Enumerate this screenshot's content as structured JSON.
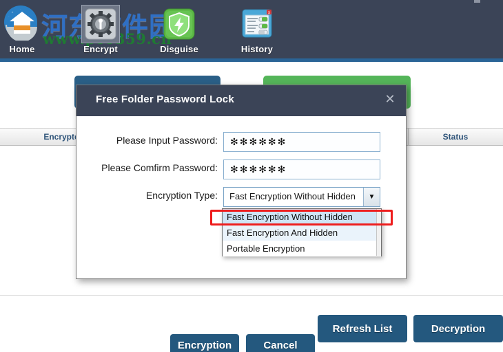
{
  "app": {
    "watermark_cn": "河东软件园",
    "watermark_url": "www.pc0359.cn"
  },
  "toolbar": {
    "items": [
      {
        "label": "Home",
        "icon": "home-icon",
        "selected": false
      },
      {
        "label": "Encrypt",
        "icon": "encrypt-gear-icon",
        "selected": true
      },
      {
        "label": "Disguise",
        "icon": "disguise-shield-icon",
        "selected": false
      },
      {
        "label": "History",
        "icon": "history-window-icon",
        "selected": false
      }
    ]
  },
  "actions": {
    "encrypt_folder_label": "",
    "decrypt_folder_label": ""
  },
  "table": {
    "columns": [
      "Encrypted File/F",
      "Status"
    ],
    "rows": []
  },
  "footer": {
    "refresh_label": "Refresh List",
    "decryption_label": "Decryption"
  },
  "dialog": {
    "title": "Free Folder Password Lock",
    "close_icon": "close-icon",
    "fields": {
      "password_label": "Please Input Password:",
      "password_value": "✻✻✻✻✻✻",
      "password_placeholder": "",
      "confirm_label": "Please Comfirm Password:",
      "confirm_value": "✻✻✻✻✻✻",
      "confirm_placeholder": "",
      "type_label": "Encryption Type:",
      "type_value": "Fast Encryption Without Hidden"
    },
    "dropdown": {
      "open": true,
      "options": [
        "Fast Encryption Without Hidden",
        "Fast Encryption And Hidden",
        "Portable Encryption"
      ],
      "selected_index": 0,
      "highlight_color": "#cfe4f5",
      "focus_ring_color": "#ee1c1c"
    },
    "buttons": {
      "confirm_label": "Encryption",
      "cancel_label": "Cancel"
    }
  },
  "colors": {
    "toolbar_bg": "#3b4457",
    "accent_blue": "#2a6496",
    "button_blue": "#24587e",
    "button_green": "#54b559",
    "header_text": "#30557a"
  }
}
